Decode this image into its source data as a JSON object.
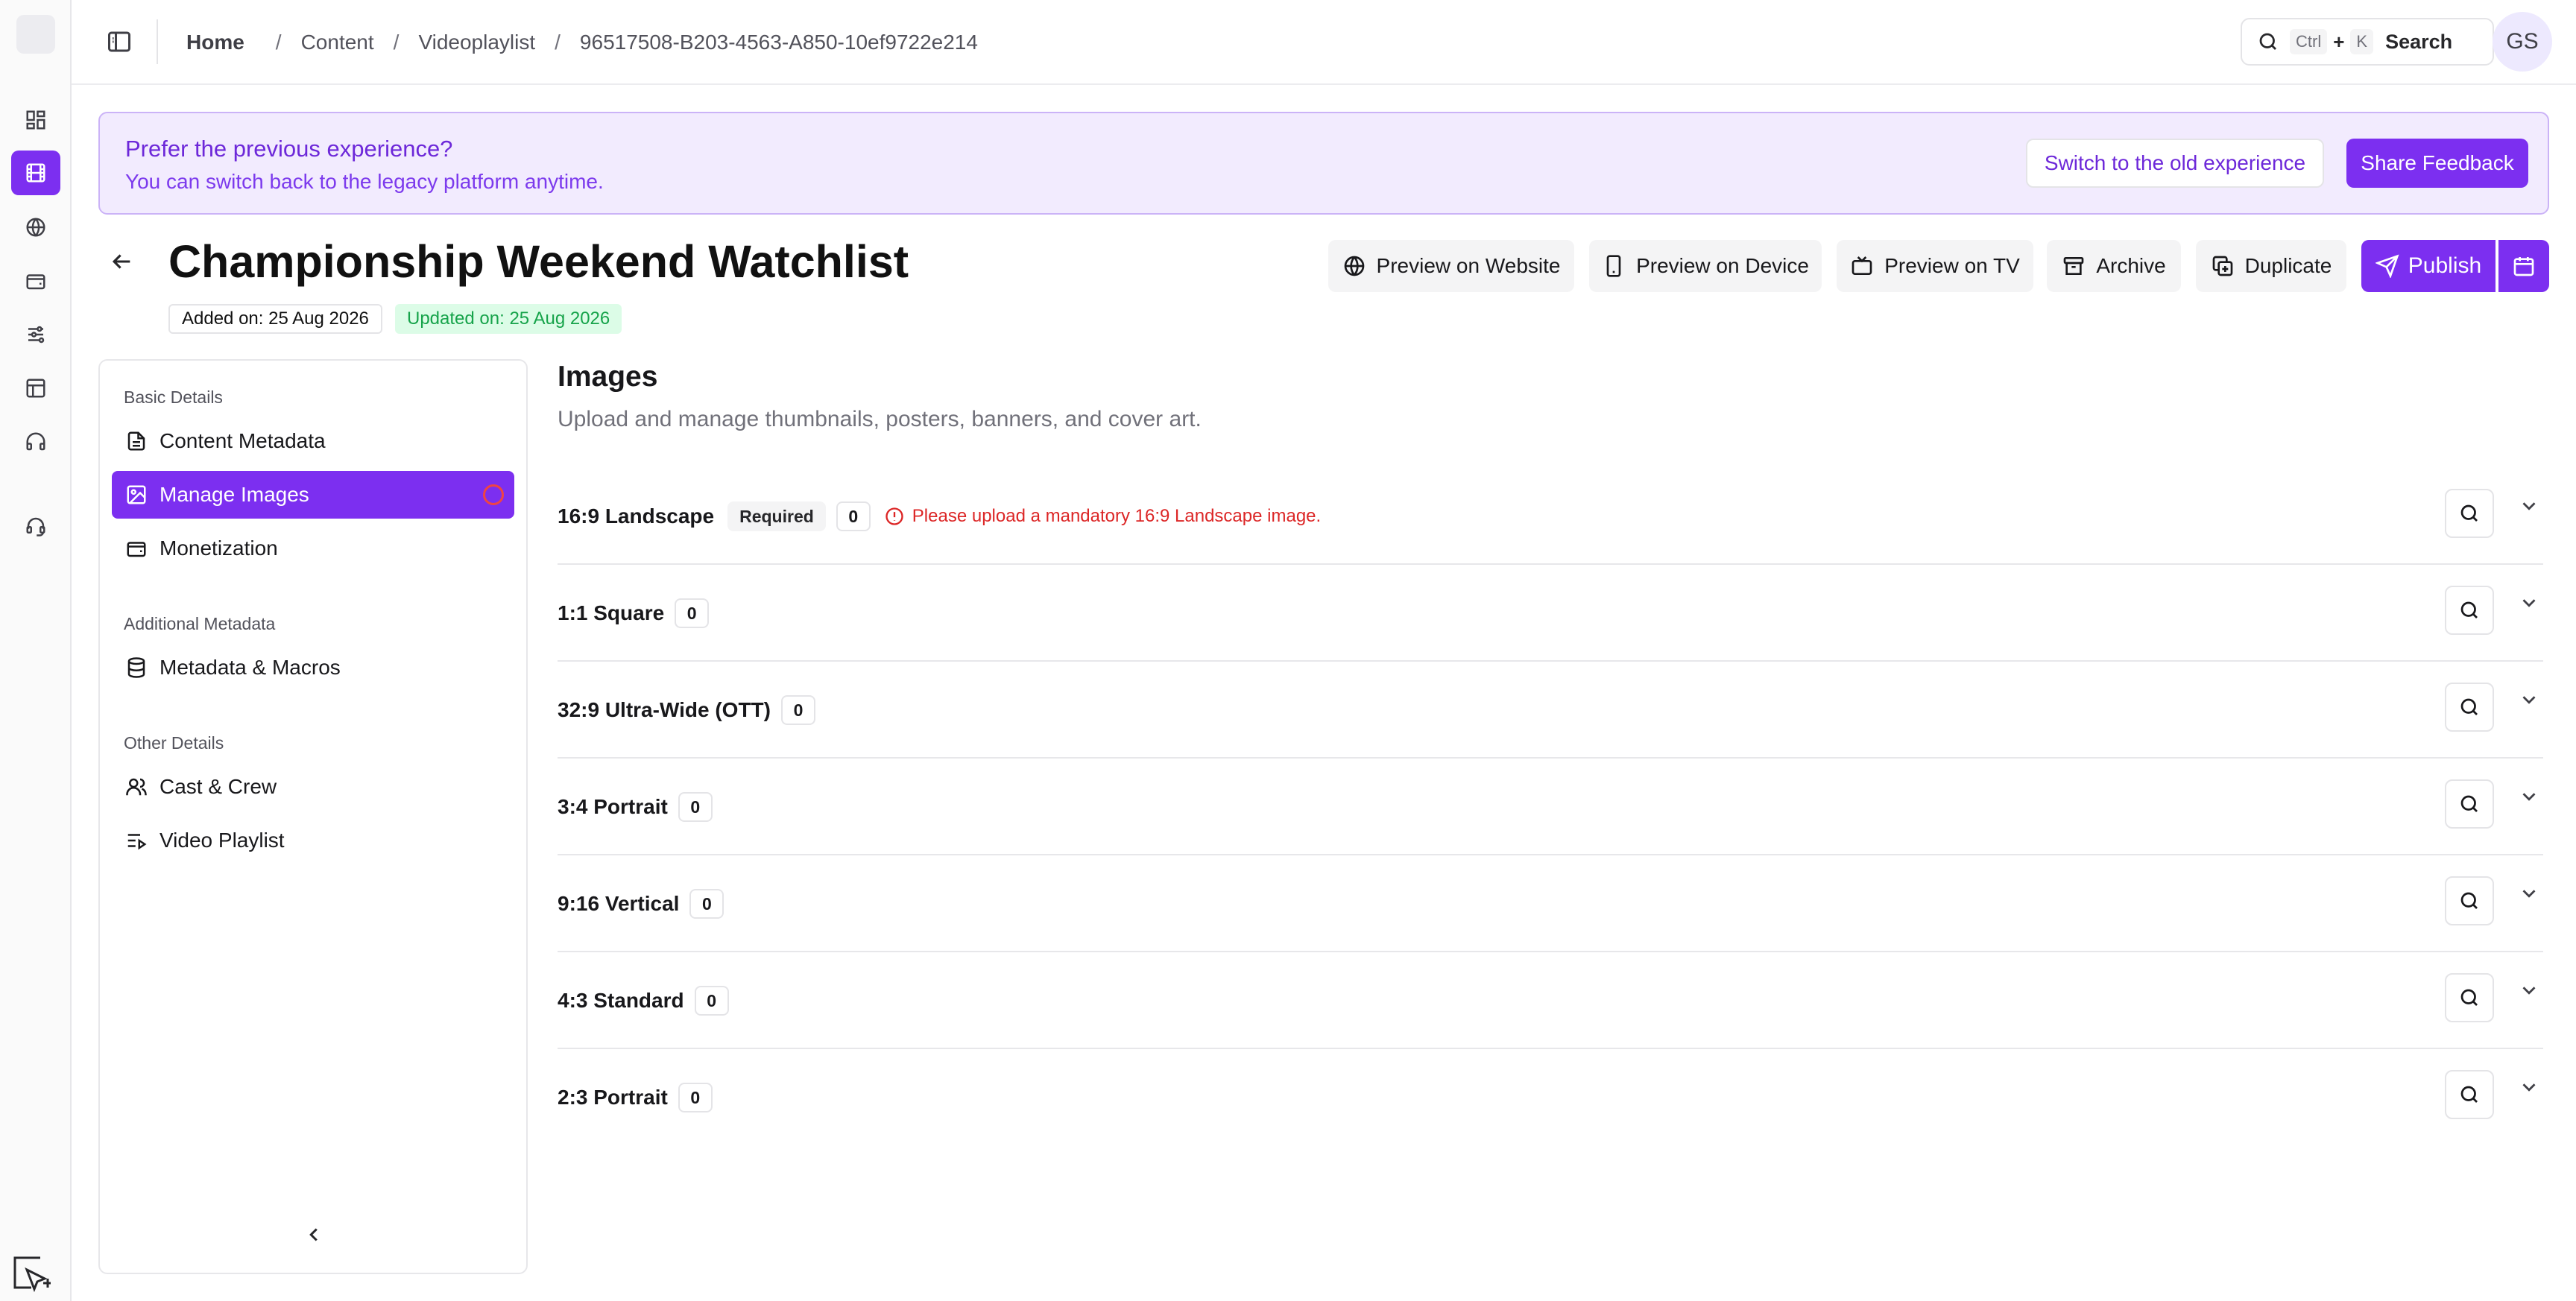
{
  "rail": {
    "items": [
      "dashboard-icon",
      "film-icon",
      "globe-icon",
      "wallet-icon",
      "sliders-icon",
      "layout-icon",
      "headphones-icon",
      "headset-icon"
    ],
    "active_index": 1
  },
  "topbar": {
    "breadcrumb": [
      "Home",
      "Content",
      "Videoplaylist",
      "96517508-B203-4563-A850-10ef9722e214"
    ],
    "search": {
      "key1": "Ctrl",
      "plus": "+",
      "key2": "K",
      "label": "Search"
    },
    "avatar_initials": "GS"
  },
  "banner": {
    "title": "Prefer the previous experience?",
    "subtitle": "You can switch back to the legacy platform anytime.",
    "switch_label": "Switch to the old experience",
    "feedback_label": "Share Feedback"
  },
  "page": {
    "title": "Championship Weekend Watchlist",
    "added": "Added on: 25 Aug 2026",
    "updated": "Updated on: 25 Aug 2026"
  },
  "actions": {
    "preview_website": "Preview on Website",
    "preview_device": "Preview on Device",
    "preview_tv": "Preview on TV",
    "archive": "Archive",
    "duplicate": "Duplicate",
    "publish": "Publish"
  },
  "sidebar": {
    "sections": [
      {
        "heading": "Basic Details",
        "items": [
          "Content Metadata",
          "Manage Images",
          "Monetization"
        ]
      },
      {
        "heading": "Additional Metadata",
        "items": [
          "Metadata & Macros"
        ]
      },
      {
        "heading": "Other Details",
        "items": [
          "Cast & Crew",
          "Video Playlist"
        ]
      }
    ],
    "active_item": "Manage Images"
  },
  "content": {
    "title": "Images",
    "subtitle": "Upload and manage thumbnails, posters, banners, and cover art.",
    "rows": [
      {
        "label": "16:9 Landscape",
        "badge": "Required",
        "count": "0",
        "error": "Please upload a mandatory 16:9 Landscape image."
      },
      {
        "label": "1:1 Square",
        "count": "0"
      },
      {
        "label": "32:9 Ultra-Wide (OTT)",
        "count": "0"
      },
      {
        "label": "3:4 Portrait",
        "count": "0"
      },
      {
        "label": "9:16 Vertical",
        "count": "0"
      },
      {
        "label": "4:3 Standard",
        "count": "0"
      },
      {
        "label": "2:3 Portrait",
        "count": "0"
      }
    ]
  },
  "colors": {
    "accent": "#7c2ff0",
    "banner_bg": "#f2ebfe",
    "error": "#dc2626",
    "success": "#16a34a"
  }
}
